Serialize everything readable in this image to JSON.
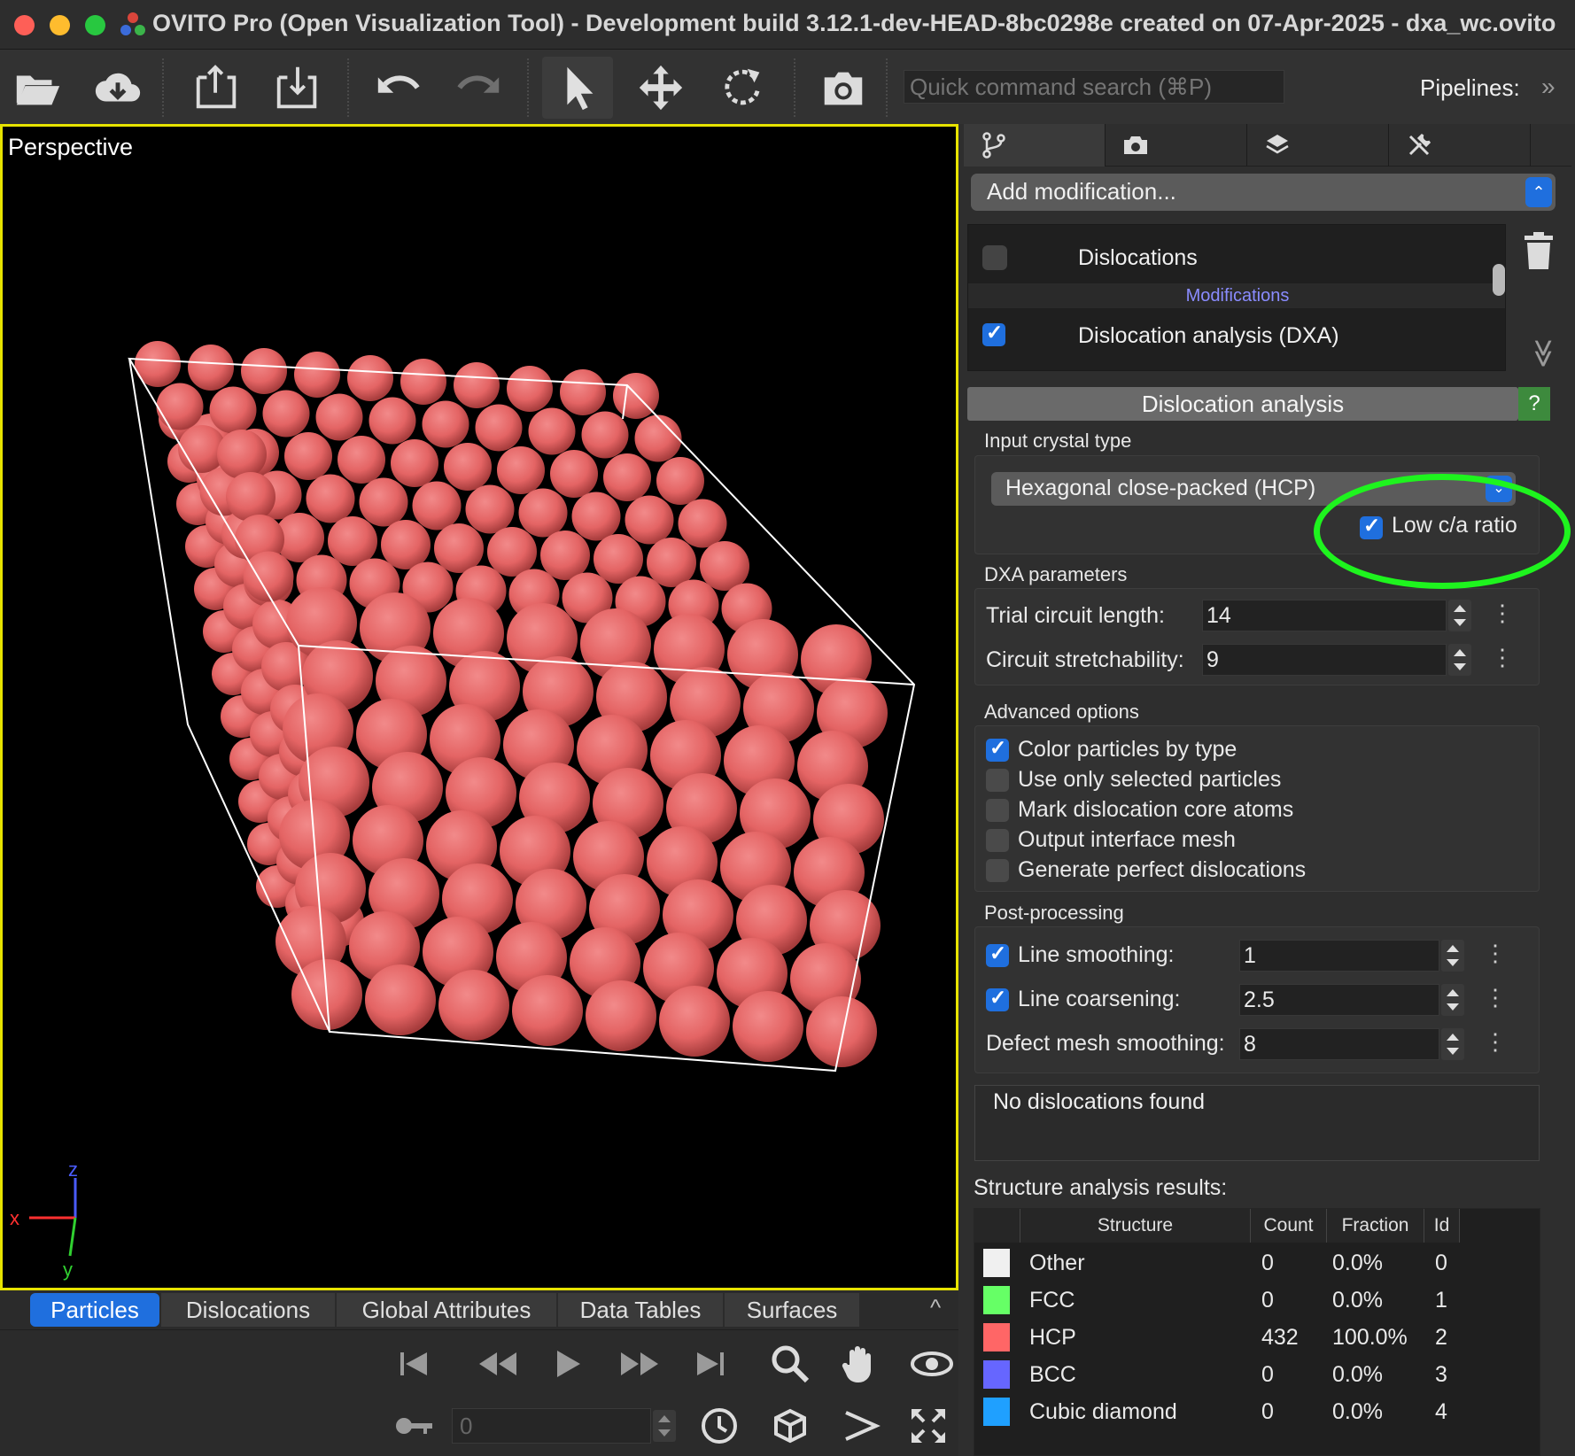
{
  "window": {
    "title": "OVITO Pro (Open Visualization Tool) - Development build 3.12.1-dev-HEAD-8bc0298e created on 07-Apr-2025 - dxa_wc.ovito"
  },
  "toolbar": {
    "search_placeholder": "Quick command search (⌘P)",
    "pipelines_label": "Pipelines:",
    "pipelines_chevron": "»"
  },
  "viewport": {
    "label": "Perspective",
    "axis_x": "x",
    "axis_y": "y",
    "axis_z": "z",
    "particle_color": "#e46464"
  },
  "bottom_tabs": [
    "Particles",
    "Dislocations",
    "Global Attributes",
    "Data Tables",
    "Surfaces"
  ],
  "bottom": {
    "collapse": "^",
    "time_value": "0"
  },
  "right_panel": {
    "add_modification": "Add modification...",
    "pipeline_items": [
      {
        "label": "Dislocations",
        "checked": false
      },
      {
        "label": "Modifications",
        "is_section": true
      },
      {
        "label": "Dislocation analysis (DXA)",
        "checked": true
      }
    ],
    "list_chevron": "≫",
    "section_title": "Dislocation analysis",
    "help_label": "?",
    "input_crystal_title": "Input crystal type",
    "crystal_type": "Hexagonal close-packed (HCP)",
    "low_ca_label": "Low c/a ratio",
    "dxa_params_title": "DXA parameters",
    "trial_circuit_label": "Trial circuit length:",
    "trial_circuit_value": "14",
    "stretch_label": "Circuit stretchability:",
    "stretch_value": "9",
    "advanced_title": "Advanced options",
    "advanced_options": [
      {
        "label": "Color particles by type",
        "checked": true
      },
      {
        "label": "Use only selected particles",
        "checked": false
      },
      {
        "label": "Mark dislocation core atoms",
        "checked": false
      },
      {
        "label": "Output interface mesh",
        "checked": false
      },
      {
        "label": "Generate perfect dislocations",
        "checked": false
      }
    ],
    "post_title": "Post-processing",
    "line_smoothing_label": "Line smoothing:",
    "line_smoothing_value": "1",
    "line_coarsening_label": "Line coarsening:",
    "line_coarsening_value": "2.5",
    "defect_mesh_label": "Defect mesh smoothing:",
    "defect_mesh_value": "8",
    "status": "No dislocations found",
    "structure_title": "Structure analysis results:",
    "table_headers": [
      "Structure",
      "Count",
      "Fraction",
      "Id"
    ],
    "table_rows": [
      {
        "color": "#f0f0f0",
        "structure": "Other",
        "count": "0",
        "fraction": "0.0%",
        "id": "0"
      },
      {
        "color": "#66ff66",
        "structure": "FCC",
        "count": "0",
        "fraction": "0.0%",
        "id": "1"
      },
      {
        "color": "#ff6666",
        "structure": "HCP",
        "count": "432",
        "fraction": "100.0%",
        "id": "2"
      },
      {
        "color": "#6666ff",
        "structure": "BCC",
        "count": "0",
        "fraction": "0.0%",
        "id": "3"
      },
      {
        "color": "#1fa0ff",
        "structure": "Cubic diamond",
        "count": "0",
        "fraction": "0.0%",
        "id": "4"
      }
    ]
  },
  "colors": {
    "accent": "#1f6fde",
    "highlight": "#1ef41e",
    "viewport_border": "#e7e300"
  }
}
